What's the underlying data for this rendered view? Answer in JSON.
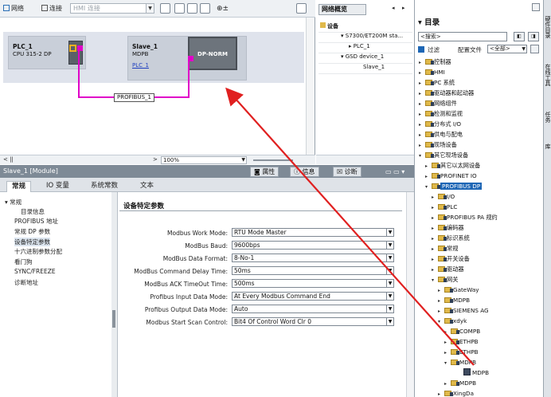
{
  "net_toolbar": {
    "network_label": "网络",
    "connect_label": "连接",
    "connect_combo": "HMI 连接",
    "zoom": "100%"
  },
  "devices": {
    "plc": {
      "name": "PLC_1",
      "type": "CPU 315-2 DP"
    },
    "slave": {
      "name": "Slave_1",
      "type": "MDPB",
      "link": "PLC_1",
      "module_label": "DP-NORM"
    },
    "bus_label": "PROFIBUS_1"
  },
  "overview": {
    "tab": "网络概览",
    "rows": [
      "设备",
      "S7300/ET200M sta...",
      "PLC_1",
      "GSD device_1",
      "Slave_1"
    ]
  },
  "inspector": {
    "title": "Slave_1 [Module]",
    "top_tabs": [
      "属性",
      "信息",
      "诊断"
    ],
    "tabs": [
      "常规",
      "IO 变量",
      "系统常数",
      "文本"
    ],
    "nav": [
      "常规",
      "目录信息",
      "PROFIBUS 地址",
      "常规 DP 参数",
      "设备特定参数",
      "十六进制参数分配",
      "看门狗",
      "SYNC/FREEZE",
      "诊断地址"
    ],
    "section_title": "设备特定参数",
    "params": [
      {
        "label": "Modbus Work Mode:",
        "value": "RTU Mode Master"
      },
      {
        "label": "ModBus Baud:",
        "value": "9600bps"
      },
      {
        "label": "ModBus Data Format:",
        "value": "8-No-1"
      },
      {
        "label": "ModBus Command Delay Time:",
        "value": "50ms"
      },
      {
        "label": "ModBus ACK TimeOut Time:",
        "value": "500ms"
      },
      {
        "label": "Profibus Input Data Mode:",
        "value": "At Every Modbus Command End"
      },
      {
        "label": "Profibus Output Data Mode:",
        "value": "Auto"
      },
      {
        "label": "Modbus Start Scan Control:",
        "value": "Bit4 Of Control Word Clr 0"
      }
    ]
  },
  "catalog": {
    "header": "目录",
    "search_placeholder": "<搜索>",
    "filter_label": "过滤",
    "profile_label": "配置文件",
    "profile_value": "<全部>",
    "tree": [
      "控制器",
      "HMI",
      "PC 系统",
      "驱动器和起动器",
      "网络组件",
      "检测和监视",
      "分布式 I/O",
      "供电与配电",
      "现场设备",
      "其它现场设备",
      "其它以太网设备",
      "PROFINET IO",
      "PROFIBUS DP",
      "I/O",
      "PLC",
      "PROFIBUS PA 规约",
      "编码器",
      "标识系统",
      "常规",
      "开关设备",
      "驱动器",
      "网关",
      "GateWay",
      "MDPB",
      "SIEMENS AG",
      "xdyk",
      "COMPB",
      "ETHPB",
      "ETHPB",
      "MDPB",
      "MDPB",
      "MDPB",
      "XingDa"
    ]
  },
  "side_tabs": [
    "硬件目录",
    "在线工具",
    "任务",
    "库"
  ],
  "colors": {
    "bus": "#e000c8",
    "selection": "#1d66b5",
    "arrow": "#e02020"
  }
}
